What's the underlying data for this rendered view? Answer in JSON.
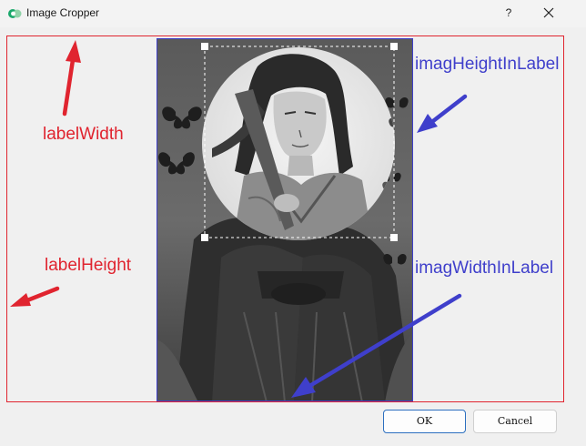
{
  "window": {
    "title": "Image Cropper",
    "help_label": "?",
    "icons": {
      "app": "image-cropper-app-icon",
      "close": "close-icon"
    }
  },
  "annotations": {
    "label_width": "labelWidth",
    "label_height": "labelHeight",
    "image_height_in_label": "imagHeightInLabel",
    "image_width_in_label": "imagWidthInLabel"
  },
  "colors": {
    "label_border": "#e0242f",
    "image_border": "#4040c8",
    "annotation_red": "#e0242f",
    "annotation_blue": "#3f3fcb",
    "crop_handle": "#ffffff"
  },
  "buttons": {
    "ok": "OK",
    "cancel": "Cancel"
  }
}
